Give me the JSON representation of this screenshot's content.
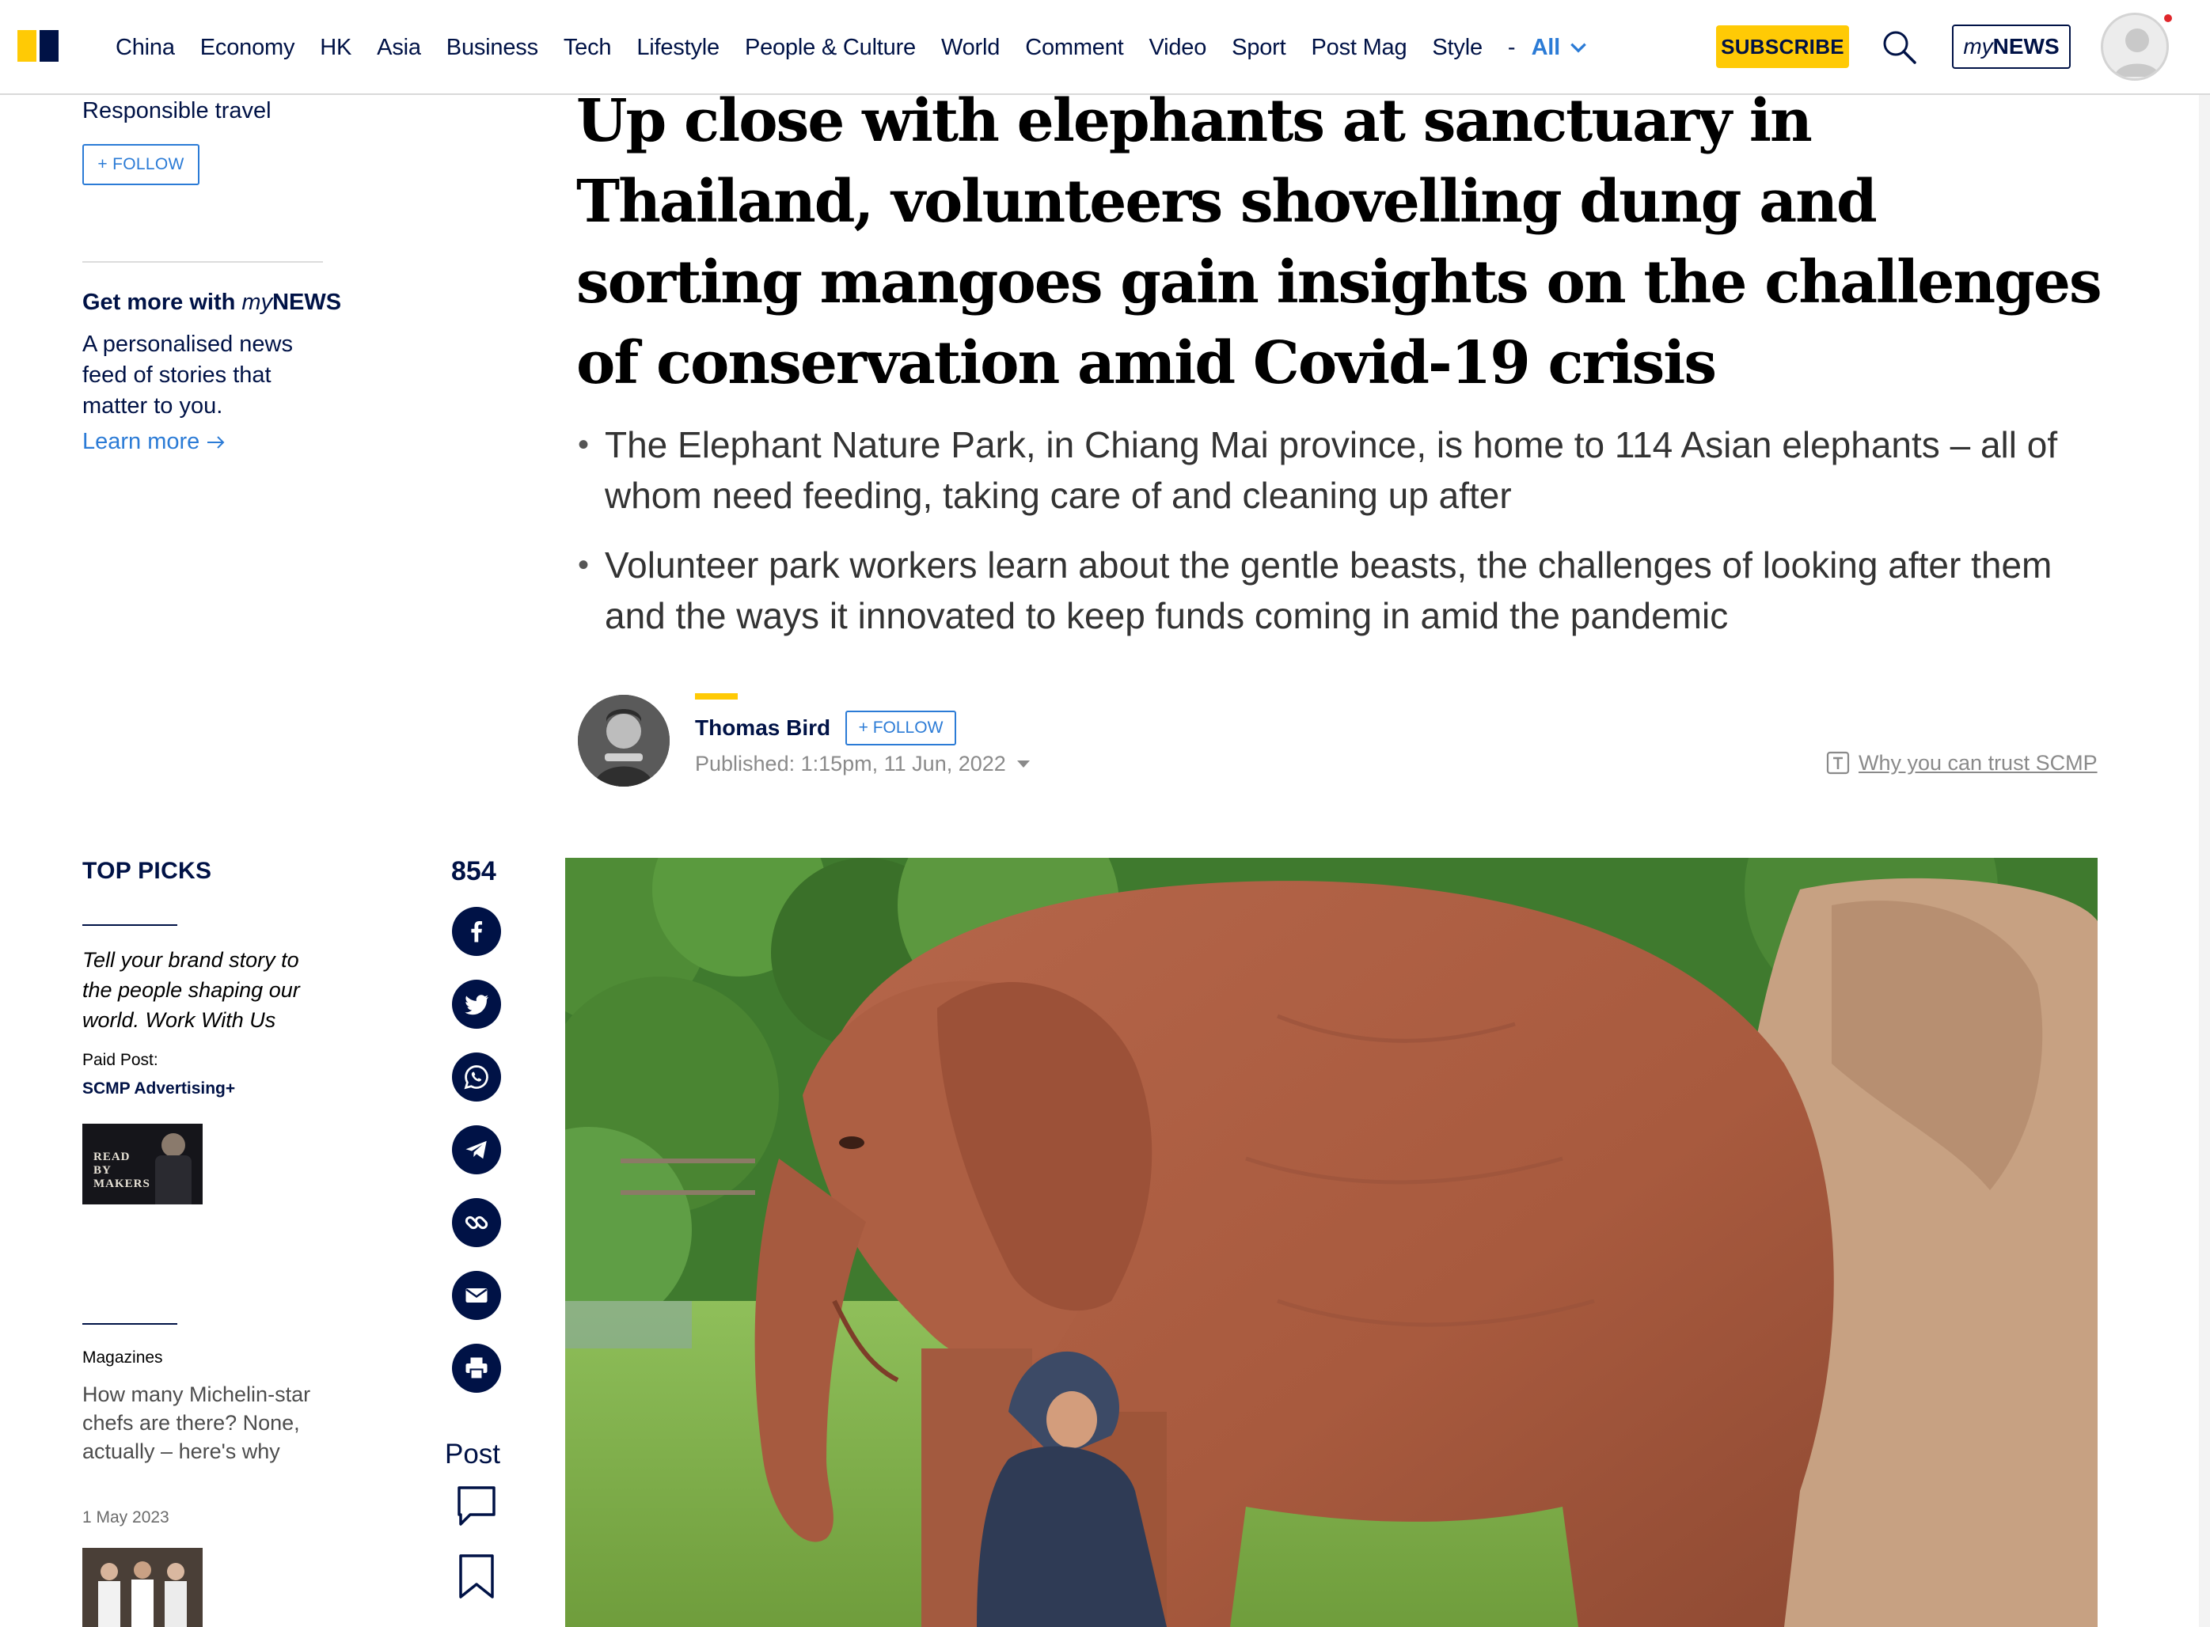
{
  "nav": {
    "items": [
      "China",
      "Economy",
      "HK",
      "Asia",
      "Business",
      "Tech",
      "Lifestyle",
      "People & Culture",
      "World",
      "Comment",
      "Video",
      "Sport",
      "Post Mag",
      "Style"
    ],
    "separator": "-",
    "all_label": "All",
    "subscribe_label": "SUBSCRIBE",
    "mynews_my": "my",
    "mynews_news": "NEWS",
    "icons": [
      "search-icon",
      "chevron-down-icon",
      "user-icon"
    ]
  },
  "sidebar": {
    "section_name": "Responsible travel",
    "follow_label": "+ FOLLOW",
    "promo_title_prefix": "Get more with ",
    "promo_title_my": "my",
    "promo_title_news": "NEWS",
    "promo_desc": "A personalised news feed of stories that matter to you.",
    "learn_more": "Learn more",
    "top_picks_title": "TOP PICKS",
    "top_pick_text": "Tell your brand story to the people shaping our world. Work With Us",
    "paid_label": "Paid Post:",
    "paid_source": "SCMP Advertising+",
    "paid_thumb_text": "READ BY MAKERS",
    "magazines_label": "Magazines",
    "magazine_story": "How many Michelin-star chefs are there? None, actually – here's why",
    "magazine_date": "1 May 2023"
  },
  "share": {
    "count": "854",
    "icons": [
      "facebook-icon",
      "twitter-icon",
      "whatsapp-icon",
      "telegram-icon",
      "link-icon",
      "email-icon",
      "print-icon"
    ],
    "post_label": "Post"
  },
  "article": {
    "headline": "Up close with elephants at sanctuary in Thailand, volunteers shovelling dung and sorting mangoes gain insights on the challenges of conservation amid Covid-19 crisis",
    "bullets": [
      "The Elephant Nature Park, in Chiang Mai province, is home to 114 Asian elephants – all of whom need feeding, taking care of and cleaning up after",
      "Volunteer park workers learn about the gentle beasts, the challenges of looking after them and the ways it innovated to keep funds coming in amid the pandemic"
    ],
    "author": "Thomas Bird",
    "author_follow": "+ FOLLOW",
    "published": "Published: 1:15pm, 11 Jun, 2022",
    "trust_label": "Why you can trust SCMP"
  },
  "colors": {
    "brand_yellow": "#ffca05",
    "brand_navy": "#001246",
    "link_blue": "#2b7bd6"
  }
}
